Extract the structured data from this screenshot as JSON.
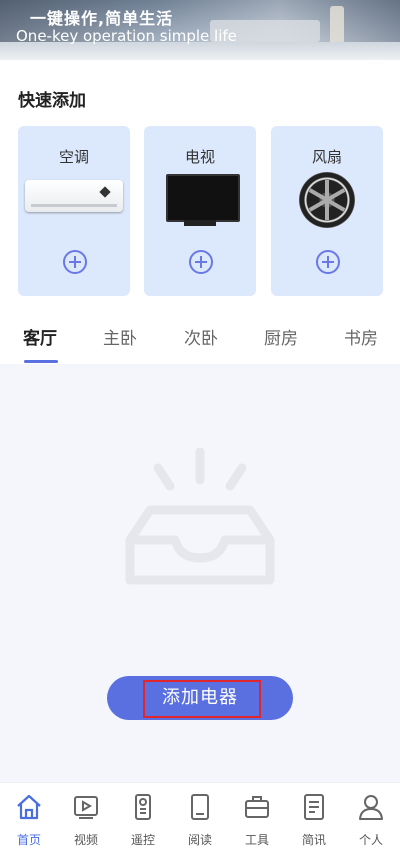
{
  "banner": {
    "title": "一键操作,简单生活",
    "subtitle": "One-key operation simple life"
  },
  "quick_add": {
    "title": "快速添加",
    "items": [
      {
        "label": "空调"
      },
      {
        "label": "电视"
      },
      {
        "label": "风扇"
      }
    ]
  },
  "rooms": {
    "tabs": [
      "客厅",
      "主卧",
      "次卧",
      "厨房",
      "书房"
    ],
    "active_index": 0
  },
  "add_device_button": {
    "label": "添加电器"
  },
  "bottom_nav": {
    "items": [
      {
        "label": "首页",
        "icon": "home-icon"
      },
      {
        "label": "视频",
        "icon": "video-icon"
      },
      {
        "label": "遥控",
        "icon": "remote-icon"
      },
      {
        "label": "阅读",
        "icon": "book-icon"
      },
      {
        "label": "工具",
        "icon": "toolbox-icon"
      },
      {
        "label": "简讯",
        "icon": "news-icon"
      },
      {
        "label": "个人",
        "icon": "person-icon"
      }
    ],
    "active_index": 0
  },
  "colors": {
    "accent": "#5a6fe0",
    "card_bg": "#dce8fc",
    "highlight": "#e0262a"
  }
}
